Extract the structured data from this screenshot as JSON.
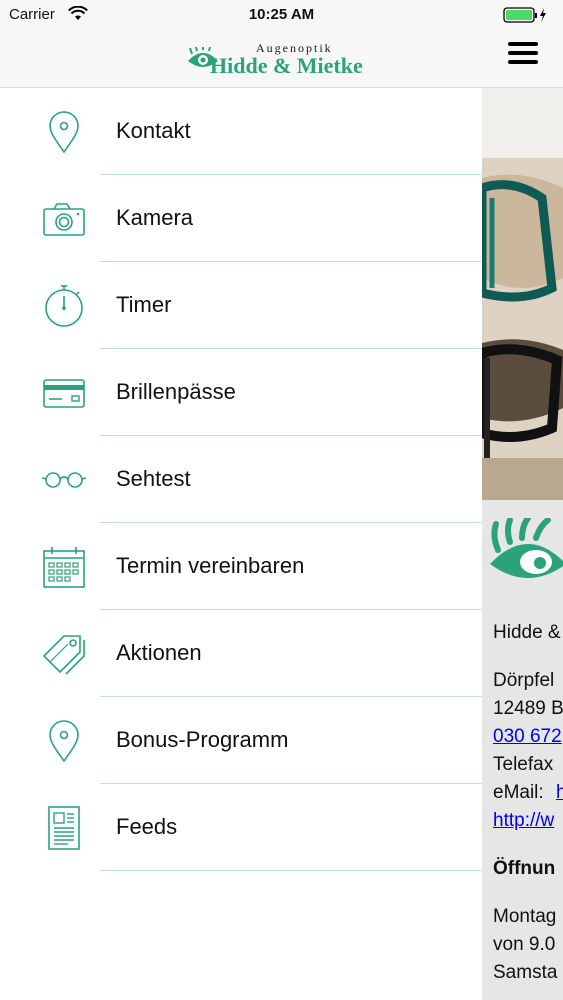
{
  "status_bar": {
    "carrier": "Carrier",
    "time": "10:25 AM"
  },
  "header": {
    "logo_small": "Augenoptik",
    "logo_main": "Hidde & Mietke"
  },
  "menu": {
    "items": [
      {
        "label": "Kontakt",
        "icon": "location-pin-icon"
      },
      {
        "label": "Kamera",
        "icon": "camera-icon"
      },
      {
        "label": "Timer",
        "icon": "stopwatch-icon"
      },
      {
        "label": "Brillenpässe",
        "icon": "card-icon"
      },
      {
        "label": "Sehtest",
        "icon": "glasses-icon"
      },
      {
        "label": "Termin vereinbaren",
        "icon": "calendar-icon"
      },
      {
        "label": "Aktionen",
        "icon": "tags-icon"
      },
      {
        "label": "Bonus-Programm",
        "icon": "location-pin-icon"
      },
      {
        "label": "Feeds",
        "icon": "document-icon"
      }
    ]
  },
  "background_page": {
    "name": "Hidde &",
    "address_1": "Dörpfel",
    "address_2": "12489 B",
    "phone": "030 672",
    "fax": "Telefax",
    "email_label": "eMail:",
    "email_link": "h",
    "web_link": "http://w",
    "hours_heading": "Öffnun",
    "hours_1": "Montag",
    "hours_2": "von 9.0",
    "hours_3": "Samsta"
  },
  "colors": {
    "accent": "#2aa37a",
    "divider": "#bfe3d6",
    "link": "#0000ee"
  }
}
